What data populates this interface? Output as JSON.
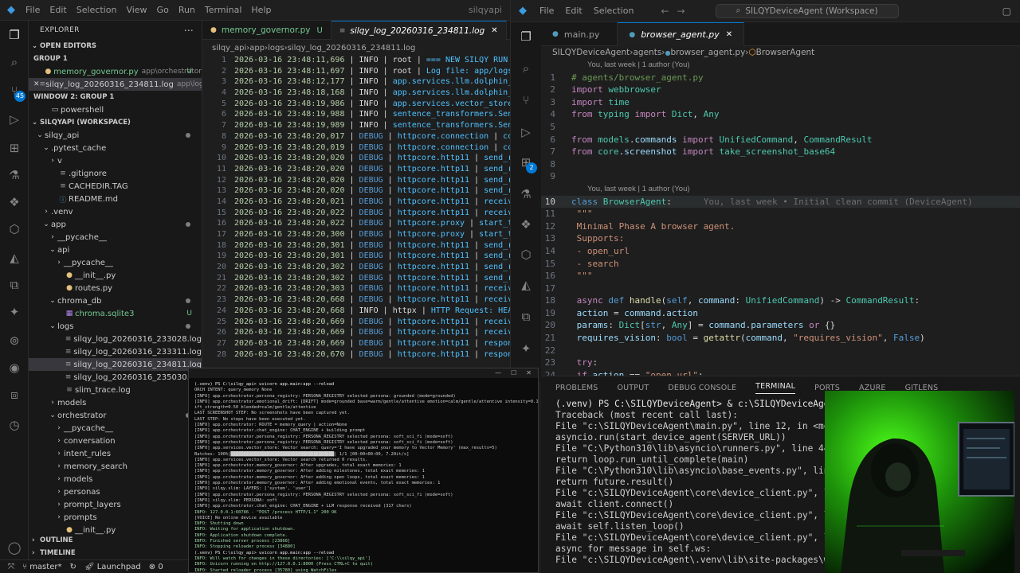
{
  "left_window": {
    "menu": [
      "File",
      "Edit",
      "Selection",
      "View",
      "Go",
      "Run",
      "Terminal",
      "Help"
    ],
    "title_partial": "silqyapi",
    "activity_badge": "45",
    "explorer_title": "EXPLORER",
    "sections": {
      "open_editors": "OPEN EDITORS",
      "group1": "GROUP 1",
      "window2_group": "WINDOW 2: GROUP 1",
      "workspace": "SILQYAPI (WORKSPACE)",
      "outline": "OUTLINE",
      "timeline": "TIMELINE"
    },
    "open_editors": [
      {
        "name": "memory_governor.py",
        "path": "app\\orchestrator",
        "status": "U"
      },
      {
        "name": "silqy_log_20260316_234811.log",
        "path": "app\\logs",
        "status": ""
      }
    ],
    "window2_item": "powershell",
    "tree": [
      {
        "label": "silqy_api",
        "indent": 0,
        "chev": "⌄",
        "kind": "folder",
        "dot": true
      },
      {
        "label": ".pytest_cache",
        "indent": 1,
        "chev": "⌄",
        "kind": "folder"
      },
      {
        "label": "v",
        "indent": 2,
        "chev": "›",
        "kind": "folder"
      },
      {
        "label": ".gitignore",
        "indent": 2,
        "chev": "",
        "kind": "file"
      },
      {
        "label": "CACHEDIR.TAG",
        "indent": 2,
        "chev": "",
        "kind": "file"
      },
      {
        "label": "README.md",
        "indent": 2,
        "chev": "",
        "kind": "md"
      },
      {
        "label": ".venv",
        "indent": 1,
        "chev": "›",
        "kind": "folder"
      },
      {
        "label": "app",
        "indent": 1,
        "chev": "⌄",
        "kind": "folder",
        "dot": true
      },
      {
        "label": "__pycache__",
        "indent": 2,
        "chev": "›",
        "kind": "folder"
      },
      {
        "label": "api",
        "indent": 2,
        "chev": "⌄",
        "kind": "folder"
      },
      {
        "label": "__pycache__",
        "indent": 3,
        "chev": "›",
        "kind": "folder"
      },
      {
        "label": "__init__.py",
        "indent": 3,
        "chev": "",
        "kind": "py"
      },
      {
        "label": "routes.py",
        "indent": 3,
        "chev": "",
        "kind": "py"
      },
      {
        "label": "chroma_db",
        "indent": 2,
        "chev": "⌄",
        "kind": "folder",
        "dot": true
      },
      {
        "label": "chroma.sqlite3",
        "indent": 3,
        "chev": "",
        "kind": "db",
        "status": "U"
      },
      {
        "label": "logs",
        "indent": 2,
        "chev": "⌄",
        "kind": "folder",
        "dot": true
      },
      {
        "label": "silqy_log_20260316_233028.log",
        "indent": 3,
        "chev": "",
        "kind": "log"
      },
      {
        "label": "silqy_log_20260316_233311.log",
        "indent": 3,
        "chev": "",
        "kind": "log"
      },
      {
        "label": "silqy_log_20260316_234811.log",
        "indent": 3,
        "chev": "",
        "kind": "log",
        "selected": true
      },
      {
        "label": "silqy_log_20260316_235030.log",
        "indent": 3,
        "chev": "",
        "kind": "log"
      },
      {
        "label": "slim_trace.log",
        "indent": 3,
        "chev": "",
        "kind": "log"
      },
      {
        "label": "models",
        "indent": 2,
        "chev": "›",
        "kind": "folder"
      },
      {
        "label": "orchestrator",
        "indent": 2,
        "chev": "⌄",
        "kind": "folder",
        "dot": true
      },
      {
        "label": "__pycache__",
        "indent": 3,
        "chev": "›",
        "kind": "folder"
      },
      {
        "label": "conversation",
        "indent": 3,
        "chev": "›",
        "kind": "folder"
      },
      {
        "label": "intent_rules",
        "indent": 3,
        "chev": "›",
        "kind": "folder"
      },
      {
        "label": "memory_search",
        "indent": 3,
        "chev": "›",
        "kind": "folder"
      },
      {
        "label": "models",
        "indent": 3,
        "chev": "›",
        "kind": "folder"
      },
      {
        "label": "personas",
        "indent": 3,
        "chev": "›",
        "kind": "folder"
      },
      {
        "label": "prompt_layers",
        "indent": 3,
        "chev": "›",
        "kind": "folder"
      },
      {
        "label": "prompts",
        "indent": 3,
        "chev": "›",
        "kind": "folder"
      },
      {
        "label": "__init__.py",
        "indent": 3,
        "chev": "",
        "kind": "py"
      }
    ],
    "tabs": [
      {
        "label": "memory_governor.py",
        "status": "U",
        "active": false
      },
      {
        "label": "silqy_log_20260316_234811.log",
        "status": "",
        "active": true
      }
    ],
    "breadcrumb": [
      "silqy_api",
      "app",
      "logs",
      "silqy_log_20260316_234811.log"
    ],
    "log_lines": [
      [
        "2026-03-16 23:48:11,696",
        "INFO",
        "root",
        "=== NEW SILQY RUN ST"
      ],
      [
        "2026-03-16 23:48:11,697",
        "INFO",
        "root",
        "Log file: app/logs\\s"
      ],
      [
        "2026-03-16 23:48:12,177",
        "INFO",
        "app.services.llm.dolphin_l",
        ""
      ],
      [
        "2026-03-16 23:48:18,168",
        "INFO",
        "app.services.llm.dolphin_l",
        ""
      ],
      [
        "2026-03-16 23:48:19,986",
        "INFO",
        "app.services.vector_store",
        ""
      ],
      [
        "2026-03-16 23:48:19,988",
        "INFO",
        "sentence_transformers.Sente",
        ""
      ],
      [
        "2026-03-16 23:48:19,989",
        "INFO",
        "sentence_transformers.Sente",
        ""
      ],
      [
        "2026-03-16 23:48:20,017",
        "DEBUG",
        "httpcore.connection",
        "conn"
      ],
      [
        "2026-03-16 23:48:20,019",
        "DEBUG",
        "httpcore.connection",
        "conn"
      ],
      [
        "2026-03-16 23:48:20,020",
        "DEBUG",
        "httpcore.http11",
        "send_re"
      ],
      [
        "2026-03-16 23:48:20,020",
        "DEBUG",
        "httpcore.http11",
        "send_re"
      ],
      [
        "2026-03-16 23:48:20,020",
        "DEBUG",
        "httpcore.http11",
        "send_re"
      ],
      [
        "2026-03-16 23:48:20,020",
        "DEBUG",
        "httpcore.http11",
        "send_re"
      ],
      [
        "2026-03-16 23:48:20,021",
        "DEBUG",
        "httpcore.http11",
        "receive"
      ],
      [
        "2026-03-16 23:48:20,022",
        "DEBUG",
        "httpcore.http11",
        "receive"
      ],
      [
        "2026-03-16 23:48:20,022",
        "DEBUG",
        "httpcore.proxy",
        "start_tls"
      ],
      [
        "2026-03-16 23:48:20,300",
        "DEBUG",
        "httpcore.proxy",
        "start_tls"
      ],
      [
        "2026-03-16 23:48:20,301",
        "DEBUG",
        "httpcore.http11",
        "send_re"
      ],
      [
        "2026-03-16 23:48:20,301",
        "DEBUG",
        "httpcore.http11",
        "send_re"
      ],
      [
        "2026-03-16 23:48:20,302",
        "DEBUG",
        "httpcore.http11",
        "send_re"
      ],
      [
        "2026-03-16 23:48:20,302",
        "DEBUG",
        "httpcore.http11",
        "send_re"
      ],
      [
        "2026-03-16 23:48:20,303",
        "DEBUG",
        "httpcore.http11",
        "receive"
      ],
      [
        "2026-03-16 23:48:20,668",
        "DEBUG",
        "httpcore.http11",
        "receive"
      ],
      [
        "2026-03-16 23:48:20,668",
        "INFO",
        "httpx",
        "HTTP Request: HEAD"
      ],
      [
        "2026-03-16 23:48:20,669",
        "DEBUG",
        "httpcore.http11",
        "receive"
      ],
      [
        "2026-03-16 23:48:20,669",
        "DEBUG",
        "httpcore.http11",
        "receive"
      ],
      [
        "2026-03-16 23:48:20,669",
        "DEBUG",
        "httpcore.http11",
        "response"
      ],
      [
        "2026-03-16 23:48:20,670",
        "DEBUG",
        "httpcore.http11",
        "response"
      ]
    ],
    "status": {
      "branch": "master*",
      "launch": "Launchpad",
      "counts": "0"
    }
  },
  "popup_terminal": {
    "title_buttons": [
      "—",
      "☐",
      "✕"
    ],
    "lines": [
      "(.venv) PS C:\\silqy_api> uvicorn app.main:app --reload",
      "ORCH INTENT: query_memory None",
      "[INFO] app.orchestrator.persona_registry: PERSONA_REGISTRY selected persona: grounded (mode=grounded)",
      "[INFO] app.orchestrator.emotional_drift: [DRIFT] mode=grounded base=warm/gentle/attentive emotion=calm/gentle/attentive intensity=0.15 dr",
      "ift_strength=0.50 blended=calm/gentle/attentive",
      "LAST SCREENSHOT STEP: No screenshots have been captured yet.",
      "LAST STEP: No steps have been executed yet.",
      "[INFO] app.orchestrator: ROUTE = memory_query | action=None",
      "[INFO] app.orchestrator.chat_engine: CHAT_ENGINE + building prompt",
      "[INFO] app.orchestrator.persona_registry: PERSONA_REGISTRY selected persona: soft_sci_fi (mode=soft)",
      "[INFO] app.orchestrator.persona_registry: PERSONA_REGISTRY selected persona: soft_sci_fi (mode=soft)",
      "[INFO] app.services.vector_store: Vector search: query='I have upgraded your memory to Vector Memory' (max_results=5)",
      "Batches: 100%|████████████████████████████████████████| 1/1 [00:00<00:00,  7.20it/s]",
      "[INFO] app.services.vector_store: Vector search returned 0 results.",
      "[INFO] app.orchestrator.memory_governor: After upgrades, total exact memories: 1",
      "[INFO] app.orchestrator.memory_governor: After adding milestones, total exact memories: 1",
      "[INFO] app.orchestrator.memory_governor: After adding open loops, total exact memories: 1",
      "[INFO] app.orchestrator.memory_governor: After adding emotional events, total exact memories: 1",
      "[INFO] silqy.slim: LAYERS: ['system', 'user']",
      "[INFO] app.orchestrator.persona_registry: PERSONA_REGISTRY selected persona: soft_sci_fi (mode=soft)",
      "[INFO] silqy.slim: PERSONA: soft",
      "[INFO] app.orchestrator.chat_engine: CHAT_ENGINE + LLM response received (317 chars)",
      "INFO:     127.0.0.1:60786 - \"POST /process HTTP/1.1\" 200 OK",
      "[VOICE] No online device available",
      "INFO:     Shutting down",
      "INFO:     Waiting for application shutdown.",
      "INFO:     Application shutdown complete.",
      "INFO:     Finished server process [23868]",
      "INFO:     Stopping reloader process [34880]",
      "(.venv) PS C:\\silqy_api> uvicorn app.main:app --reload",
      "INFO:     Will watch for changes in these directories: ['C:\\\\silqy_api']",
      "INFO:     Uvicorn running on http://127.0.0.1:8000 (Press CTRL+C to quit)",
      "INFO:     Started reloader process [35780] using WatchFiles"
    ]
  },
  "right_window": {
    "menu": [
      "File",
      "Edit",
      "Selection"
    ],
    "search_text": "SILQYDeviceAgent (Workspace)",
    "activity_badge": "2",
    "tabs": [
      {
        "label": "main.py",
        "active": false
      },
      {
        "label": "browser_agent.py",
        "active": true
      }
    ],
    "breadcrumb": [
      "SILQYDeviceAgent",
      "agents",
      "browser_agent.py",
      "BrowserAgent"
    ],
    "codelens_top": "You, last week | 1 author (You)",
    "codelens_class": "You, last week | 1 author (You)",
    "blame_text": "You, last week • Initial clean commit (DeviceAgent)",
    "code": [
      {
        "n": "1",
        "t": "# agents/browser_agent.py"
      },
      {
        "n": "2",
        "t": "import webbrowser"
      },
      {
        "n": "3",
        "t": "import time"
      },
      {
        "n": "4",
        "t": "from typing import Dict, Any"
      },
      {
        "n": "5",
        "t": ""
      },
      {
        "n": "6",
        "t": "from models.commands import UnifiedCommand, CommandResult"
      },
      {
        "n": "7",
        "t": "from core.screenshot import take_screenshot_base64"
      },
      {
        "n": "8",
        "t": ""
      },
      {
        "n": "9",
        "t": ""
      },
      {
        "n": "10",
        "t": "class BrowserAgent:"
      },
      {
        "n": "11",
        "t": "    \"\"\""
      },
      {
        "n": "12",
        "t": "    Minimal Phase A browser agent."
      },
      {
        "n": "13",
        "t": "    Supports:"
      },
      {
        "n": "14",
        "t": "    - open_url"
      },
      {
        "n": "15",
        "t": "    - search"
      },
      {
        "n": "16",
        "t": "    \"\"\""
      },
      {
        "n": "17",
        "t": ""
      },
      {
        "n": "18",
        "t": "    async def handle(self, command: UnifiedCommand) -> CommandResult:"
      },
      {
        "n": "19",
        "t": "        action = command.action"
      },
      {
        "n": "20",
        "t": "        params: Dict[str, Any] = command.parameters or {}"
      },
      {
        "n": "21",
        "t": "        requires_vision: bool = getattr(command, \"requires_vision\", False)"
      },
      {
        "n": "22",
        "t": ""
      },
      {
        "n": "23",
        "t": "        try:"
      },
      {
        "n": "24",
        "t": "            if action == \"open_url\":"
      }
    ],
    "panel_tabs": [
      "PROBLEMS",
      "OUTPUT",
      "DEBUG CONSOLE",
      "TERMINAL",
      "PORTS",
      "AZURE",
      "GITLENS"
    ],
    "panel_active": "TERMINAL",
    "terminal": [
      "(.venv) PS C:\\SILQYDeviceAgent> & c:\\SILQYDeviceAgent\\.ve",
      "Traceback (most recent call last):",
      "  File \"c:\\SILQYDeviceAgent\\main.py\", line 12, in <module",
      "    asyncio.run(start_device_agent(SERVER_URL))",
      "  File \"C:\\Python310\\lib\\asyncio\\runners.py\", line 44, in",
      "    return loop.run_until_complete(main)",
      "  File \"C:\\Python310\\lib\\asyncio\\base_events.py\", line 64",
      "    return future.result()",
      "  File \"c:\\SILQYDeviceAgent\\core\\device_client.py\", line",
      "    await client.connect()",
      "  File \"c:\\SILQYDeviceAgent\\core\\device_client.py\", line",
      "    await self.listen_loop()",
      "  File \"c:\\SILQYDeviceAgent\\core\\device_client.py\", line",
      "    async for message in self.ws:",
      "  File \"c:\\SILQYDeviceAgent\\.venv\\lib\\site-packages\\webso"
    ]
  },
  "colors": {
    "editor_bg": "#1e1e1e",
    "sidebar_bg": "#181818",
    "accent": "#0078d4",
    "git_untracked": "#73c991",
    "webcam_green": "#39ff14"
  }
}
